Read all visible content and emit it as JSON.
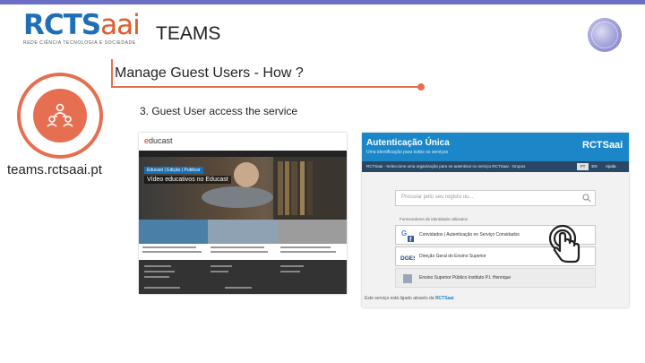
{
  "header": {
    "logo_text": "RCTS",
    "logo_accent": "aai",
    "logo_tagline": "REDE CIÊNCIA TECNOLOGIA E SOCIEDADE",
    "title": "TEAMS"
  },
  "section_title": "Manage Guest Users - How ?",
  "step_title": "3. Guest User access the service",
  "site_url": "teams.rctsaai.pt",
  "colors": {
    "accent": "#e76f51",
    "topbar": "#6b6fc5",
    "brand_blue": "#1f6fb6"
  },
  "icons": {
    "badge": "people-network-icon",
    "globe": "globe-emblem-icon",
    "pointer": "tap-hand-icon"
  },
  "educast": {
    "logo_prefix": "e",
    "logo_rest": "ducast",
    "hero_label": "Educast | Edição | Publicar",
    "hero_title": "Vídeo educativos no Educast"
  },
  "auth": {
    "title": "Autenticação Única",
    "subtitle": "Uma identificação para todos os serviços",
    "brand": "RCTSaai",
    "bar_text": "RCTSaai - Seleccione uma organização para se autenticar no serviço RCTSaai - Grupos",
    "lang_pt": "PT",
    "lang_en": "EN",
    "help": "Ajuda",
    "search_placeholder": "Procurar pelo seu registo ou...",
    "hint": "Fornecedores de identidade utilizados",
    "options": [
      {
        "label": "Convidados | Autenticação no Serviço Convidados"
      },
      {
        "label": "Direção Geral do Ensino Superior"
      },
      {
        "label": "Ensino Superior Público Instituto P.I. Henrique"
      }
    ],
    "footer_text": "Este serviço está ligado através da ",
    "footer_brand": "RCTSaai"
  }
}
